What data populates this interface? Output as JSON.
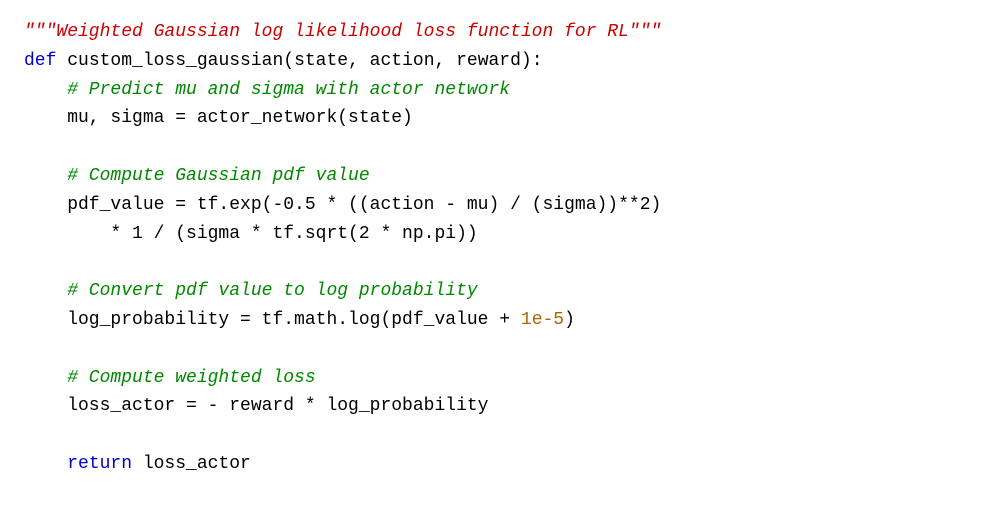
{
  "code": {
    "lines": [
      {
        "id": "line1",
        "parts": [
          {
            "text": "\"\"\"Weighted Gaussian log likelihood loss function for RL\"\"\"",
            "class": "c-string"
          }
        ]
      },
      {
        "id": "line2",
        "parts": [
          {
            "text": "def ",
            "class": "c-keyword"
          },
          {
            "text": "custom_loss_gaussian",
            "class": "c-funcname"
          },
          {
            "text": "(state, action, reward):",
            "class": "c-plain"
          }
        ]
      },
      {
        "id": "line3",
        "parts": [
          {
            "text": "    # Predict mu and sigma with actor network",
            "class": "c-comment"
          }
        ]
      },
      {
        "id": "line4",
        "parts": [
          {
            "text": "    mu, sigma = actor_network(state)",
            "class": "c-plain"
          }
        ]
      },
      {
        "id": "line5",
        "parts": [
          {
            "text": "",
            "class": "c-plain"
          }
        ]
      },
      {
        "id": "line6",
        "parts": [
          {
            "text": "    # Compute Gaussian pdf value",
            "class": "c-comment"
          }
        ]
      },
      {
        "id": "line7",
        "parts": [
          {
            "text": "    pdf_value = tf.exp(-0.5 * ((action - mu) / (sigma))**2)",
            "class": "c-plain"
          }
        ]
      },
      {
        "id": "line8",
        "parts": [
          {
            "text": "        * 1 / (sigma * tf.sqrt(2 * np.pi))",
            "class": "c-plain"
          }
        ]
      },
      {
        "id": "line9",
        "parts": [
          {
            "text": "",
            "class": "c-plain"
          }
        ]
      },
      {
        "id": "line10",
        "parts": [
          {
            "text": "    # Convert pdf value to log probability",
            "class": "c-comment"
          }
        ]
      },
      {
        "id": "line11",
        "parts": [
          {
            "text": "    log_probability = tf.math.log(pdf_value + ",
            "class": "c-plain"
          },
          {
            "text": "1e-5",
            "class": "c-number"
          },
          {
            "text": ")",
            "class": "c-plain"
          }
        ]
      },
      {
        "id": "line12",
        "parts": [
          {
            "text": "",
            "class": "c-plain"
          }
        ]
      },
      {
        "id": "line13",
        "parts": [
          {
            "text": "    # Compute weighted loss",
            "class": "c-comment"
          }
        ]
      },
      {
        "id": "line14",
        "parts": [
          {
            "text": "    loss_actor = - reward * log_probability",
            "class": "c-plain"
          }
        ]
      },
      {
        "id": "line15",
        "parts": [
          {
            "text": "",
            "class": "c-plain"
          }
        ]
      },
      {
        "id": "line16",
        "parts": [
          {
            "text": "    ",
            "class": "c-plain"
          },
          {
            "text": "return",
            "class": "c-keyword"
          },
          {
            "text": " loss_actor",
            "class": "c-plain"
          }
        ]
      }
    ]
  }
}
